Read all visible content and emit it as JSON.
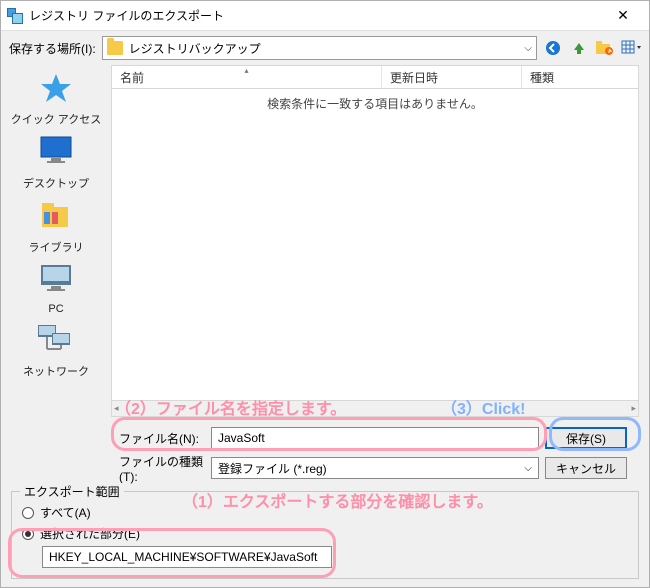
{
  "titlebar": {
    "title": "レジストリ ファイルのエクスポート"
  },
  "toolbar": {
    "location_label": "保存する場所(I):",
    "location_value": "レジストリバックアップ"
  },
  "columns": {
    "name": "名前",
    "date": "更新日時",
    "type": "種類"
  },
  "list": {
    "empty_message": "検索条件に一致する項目はありません。"
  },
  "places": {
    "quick_access": "クイック アクセス",
    "desktop": "デスクトップ",
    "libraries": "ライブラリ",
    "pc": "PC",
    "network": "ネットワーク"
  },
  "fields": {
    "filename_label": "ファイル名(N):",
    "filename_value": "JavaSoft",
    "filetype_label": "ファイルの種類(T):",
    "filetype_value": "登録ファイル (*.reg)"
  },
  "buttons": {
    "save": "保存(S)",
    "cancel": "キャンセル"
  },
  "export": {
    "legend": "エクスポート範囲",
    "all": "すべて(A)",
    "selected": "選択された部分(E)",
    "path": "HKEY_LOCAL_MACHINE¥SOFTWARE¥JavaSoft"
  },
  "annotations": {
    "step1": "（1）エクスポートする部分を確認します。",
    "step2": "（2）ファイル名を指定します。",
    "step3": "（3）Click!"
  }
}
